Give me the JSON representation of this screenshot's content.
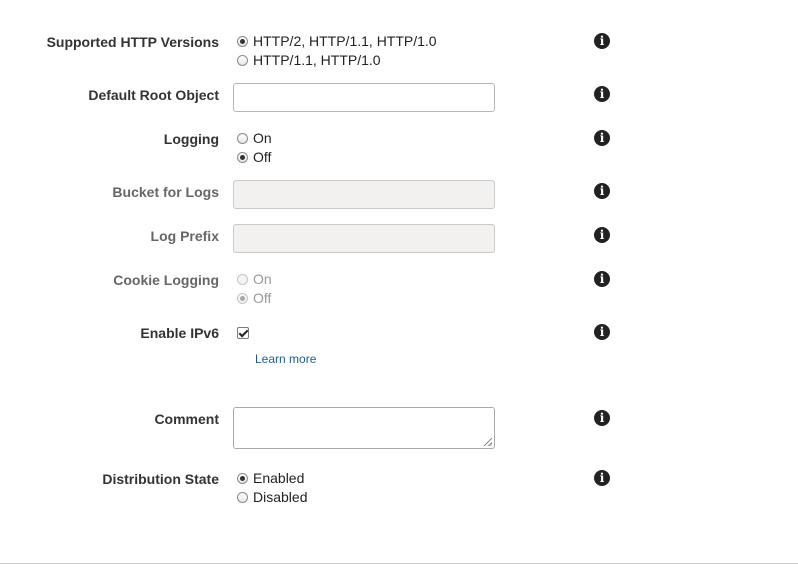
{
  "fields": {
    "http_versions": {
      "label": "Supported HTTP Versions",
      "options": [
        {
          "label": "HTTP/2, HTTP/1.1, HTTP/1.0",
          "checked": true
        },
        {
          "label": "HTTP/1.1, HTTP/1.0",
          "checked": false
        }
      ]
    },
    "default_root_object": {
      "label": "Default Root Object",
      "value": ""
    },
    "logging": {
      "label": "Logging",
      "options": [
        {
          "label": "On",
          "checked": false
        },
        {
          "label": "Off",
          "checked": true
        }
      ]
    },
    "bucket_for_logs": {
      "label": "Bucket for Logs",
      "value": "",
      "disabled": true
    },
    "log_prefix": {
      "label": "Log Prefix",
      "value": "",
      "disabled": true
    },
    "cookie_logging": {
      "label": "Cookie Logging",
      "disabled": true,
      "options": [
        {
          "label": "On",
          "checked": false
        },
        {
          "label": "Off",
          "checked": true
        }
      ]
    },
    "enable_ipv6": {
      "label": "Enable IPv6",
      "checked": true,
      "link": "Learn more"
    },
    "comment": {
      "label": "Comment",
      "value": ""
    },
    "distribution_state": {
      "label": "Distribution State",
      "options": [
        {
          "label": "Enabled",
          "checked": true
        },
        {
          "label": "Disabled",
          "checked": false
        }
      ]
    }
  },
  "icons": {
    "info": "info-icon",
    "info_glyph": "i"
  }
}
